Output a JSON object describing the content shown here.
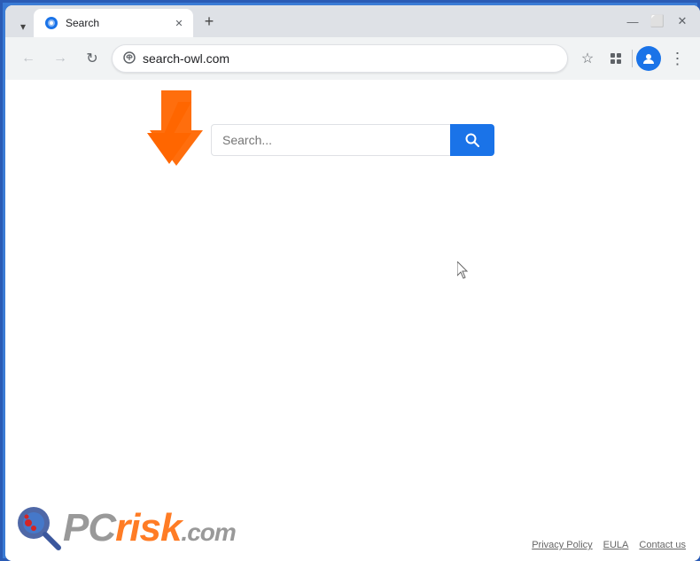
{
  "browser": {
    "tab": {
      "title": "Search",
      "favicon": "🌐"
    },
    "new_tab_label": "+",
    "window_controls": {
      "minimize": "—",
      "maximize": "⬜",
      "close": "✕"
    },
    "address_bar": {
      "url": "search-owl.com",
      "security_icon": "🔒"
    },
    "nav": {
      "back": "←",
      "forward": "→",
      "refresh": "↻"
    }
  },
  "page": {
    "search_placeholder": "Search...",
    "search_button_icon": "🔍"
  },
  "pcrisk": {
    "pc": "PC",
    "risk": "risk",
    "dot_com": ".com"
  },
  "footer": {
    "privacy_policy": "Privacy Policy",
    "eula": "EULA",
    "contact_us": "Contact us"
  },
  "icons": {
    "back_arrow": "←",
    "forward_arrow": "→",
    "refresh": "↻",
    "bookmark": "☆",
    "extensions": "🧩",
    "profile": "👤",
    "menu": "⋮",
    "tab_list": "⌄",
    "search": "⌕",
    "security": "⊙"
  },
  "colors": {
    "search_button_bg": "#1a73e8",
    "tab_active_bg": "#ffffff",
    "address_bar_bg": "#f1f3f4",
    "page_bg": "#ffffff"
  }
}
